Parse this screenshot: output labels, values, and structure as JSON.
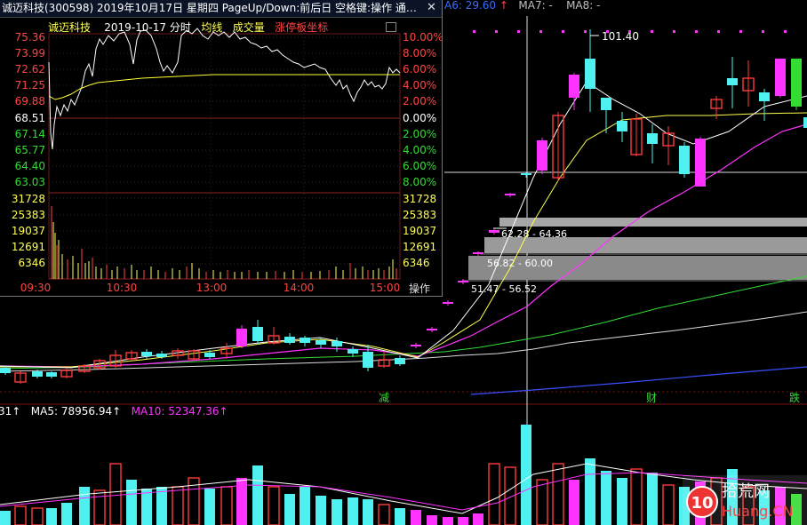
{
  "popup": {
    "title": "诚迈科技(300598)  2019年10月17日  星期四  PageUp/Down:前后日  空格键:操作  通…",
    "close": "✕",
    "header": {
      "stock_name": "诚迈科技",
      "date": "2019-10-17",
      "mode": "分时",
      "avg_label": "均线",
      "vol_label": "成交量",
      "limit_label": "涨停板坐标"
    },
    "price_labels": [
      "75.36",
      "73.99",
      "72.62",
      "71.25",
      "69.88",
      "68.51",
      "67.14",
      "65.77",
      "64.40",
      "63.03"
    ],
    "pct_labels": [
      "10.00%",
      "8.00%",
      "6.00%",
      "4.00%",
      "2.00%",
      "0.00%",
      "2.00%",
      "4.00%",
      "6.00%",
      "8.00%"
    ],
    "vol_labels": [
      "31728",
      "25383",
      "19037",
      "12691",
      "6346"
    ],
    "time_labels": [
      "09:30",
      "10:30",
      "13:00",
      "14:00",
      "15:00"
    ],
    "op_label": "操作"
  },
  "kline": {
    "legend_ma": [
      {
        "text": "A6: 29.60",
        "color": "#3a6cff"
      },
      {
        "text": "MA7: -",
        "color": "#ffffff"
      },
      {
        "text": "MA8: -",
        "color": "#ffffff"
      }
    ],
    "arrow": "↑",
    "peak_label": "101.40",
    "chip_labels": [
      "62.28 - 64.36",
      "56.82 - 60.00",
      "51.47 - 56.52"
    ],
    "markers": [
      "减",
      "财",
      "跌"
    ],
    "vol_legend": [
      {
        "text": "31↑",
        "color": "#ffffff"
      },
      {
        "text": "MA5: 78956.94↑",
        "color": "#ffffff"
      },
      {
        "text": "MA10: 52347.36↑",
        "color": "#ff33ff"
      }
    ]
  },
  "watermark": {
    "main": "拾荒网",
    "sub": "Huang.CN",
    "num": "10"
  },
  "colors": {
    "up": "#ff3b3b",
    "down": "#4ff0f0",
    "magenta": "#ff33ff",
    "yellow": "#ffff4d",
    "green": "#33dd33",
    "gray_bar": "#8f8f8f"
  }
}
